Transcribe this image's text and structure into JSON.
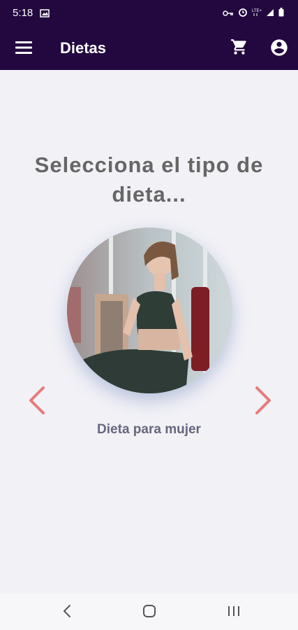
{
  "status_bar": {
    "time": "5:18",
    "icons": [
      "image-icon",
      "key-icon",
      "alarm-icon",
      "lte-icon",
      "signal-icon",
      "battery-icon"
    ]
  },
  "app_bar": {
    "title": "Dietas",
    "icons": [
      "menu-icon",
      "cart-icon",
      "account-icon"
    ],
    "background_color": "#22083f"
  },
  "main": {
    "heading": "Selecciona el tipo de dieta...",
    "carousel": {
      "current_label": "Dieta para mujer",
      "prev_icon": "chevron-left-icon",
      "next_icon": "chevron-right-icon",
      "arrow_color": "#e87a7a"
    }
  },
  "nav_bar": {
    "icons": [
      "back-icon",
      "home-icon",
      "recents-icon"
    ]
  }
}
